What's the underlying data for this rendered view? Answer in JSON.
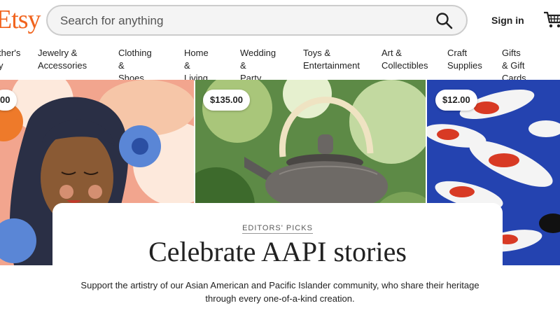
{
  "header": {
    "logo": "Etsy",
    "search_placeholder": "Search for anything",
    "signin_label": "Sign in"
  },
  "categories": [
    "ther's\ny",
    "Jewelry &\nAccessories",
    "Clothing &\nShoes",
    "Home &\nLiving",
    "Wedding &\nParty",
    "Toys &\nEntertainment",
    "Art &\nCollectibles",
    "Craft\nSupplies",
    "Gifts & Gift\nCards"
  ],
  "tiles": [
    {
      "price": "00"
    },
    {
      "price": "$135.00"
    },
    {
      "price": "$12.00"
    }
  ],
  "feature": {
    "eyebrow": "EDITORS' PICKS",
    "headline": "Celebrate AAPI stories",
    "description": "Support the artistry of our Asian American and Pacific Islander community, who share their heritage through every one-of-a-kind creation."
  },
  "colors": {
    "brand": "#f1641e"
  }
}
